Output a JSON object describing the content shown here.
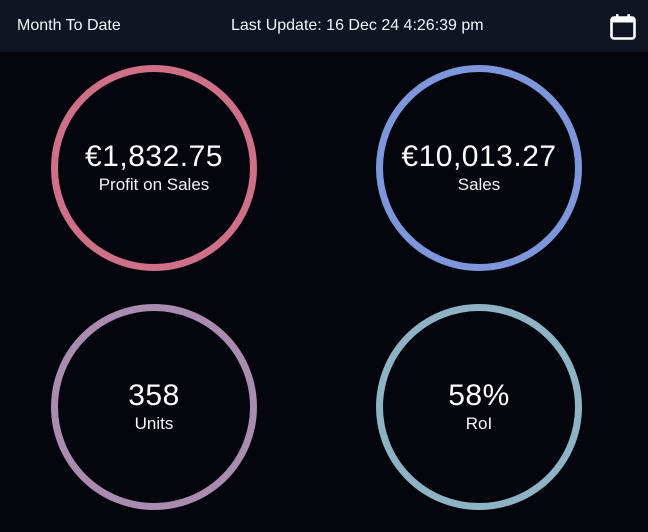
{
  "header": {
    "period_label": "Month To Date",
    "last_update": "Last Update: 16 Dec 24 4:26:39 pm",
    "calendar_icon": "calendar-icon"
  },
  "metrics": [
    {
      "value": "€1,832.75",
      "label": "Profit on Sales",
      "ring_color": "#cf7088"
    },
    {
      "value": "€10,013.27",
      "label": "Sales",
      "ring_color": "#7e96db"
    },
    {
      "value": "358",
      "label": "Units",
      "ring_color": "#a98cb0"
    },
    {
      "value": "58%",
      "label": "RoI",
      "ring_color": "#8eb3c4"
    }
  ]
}
